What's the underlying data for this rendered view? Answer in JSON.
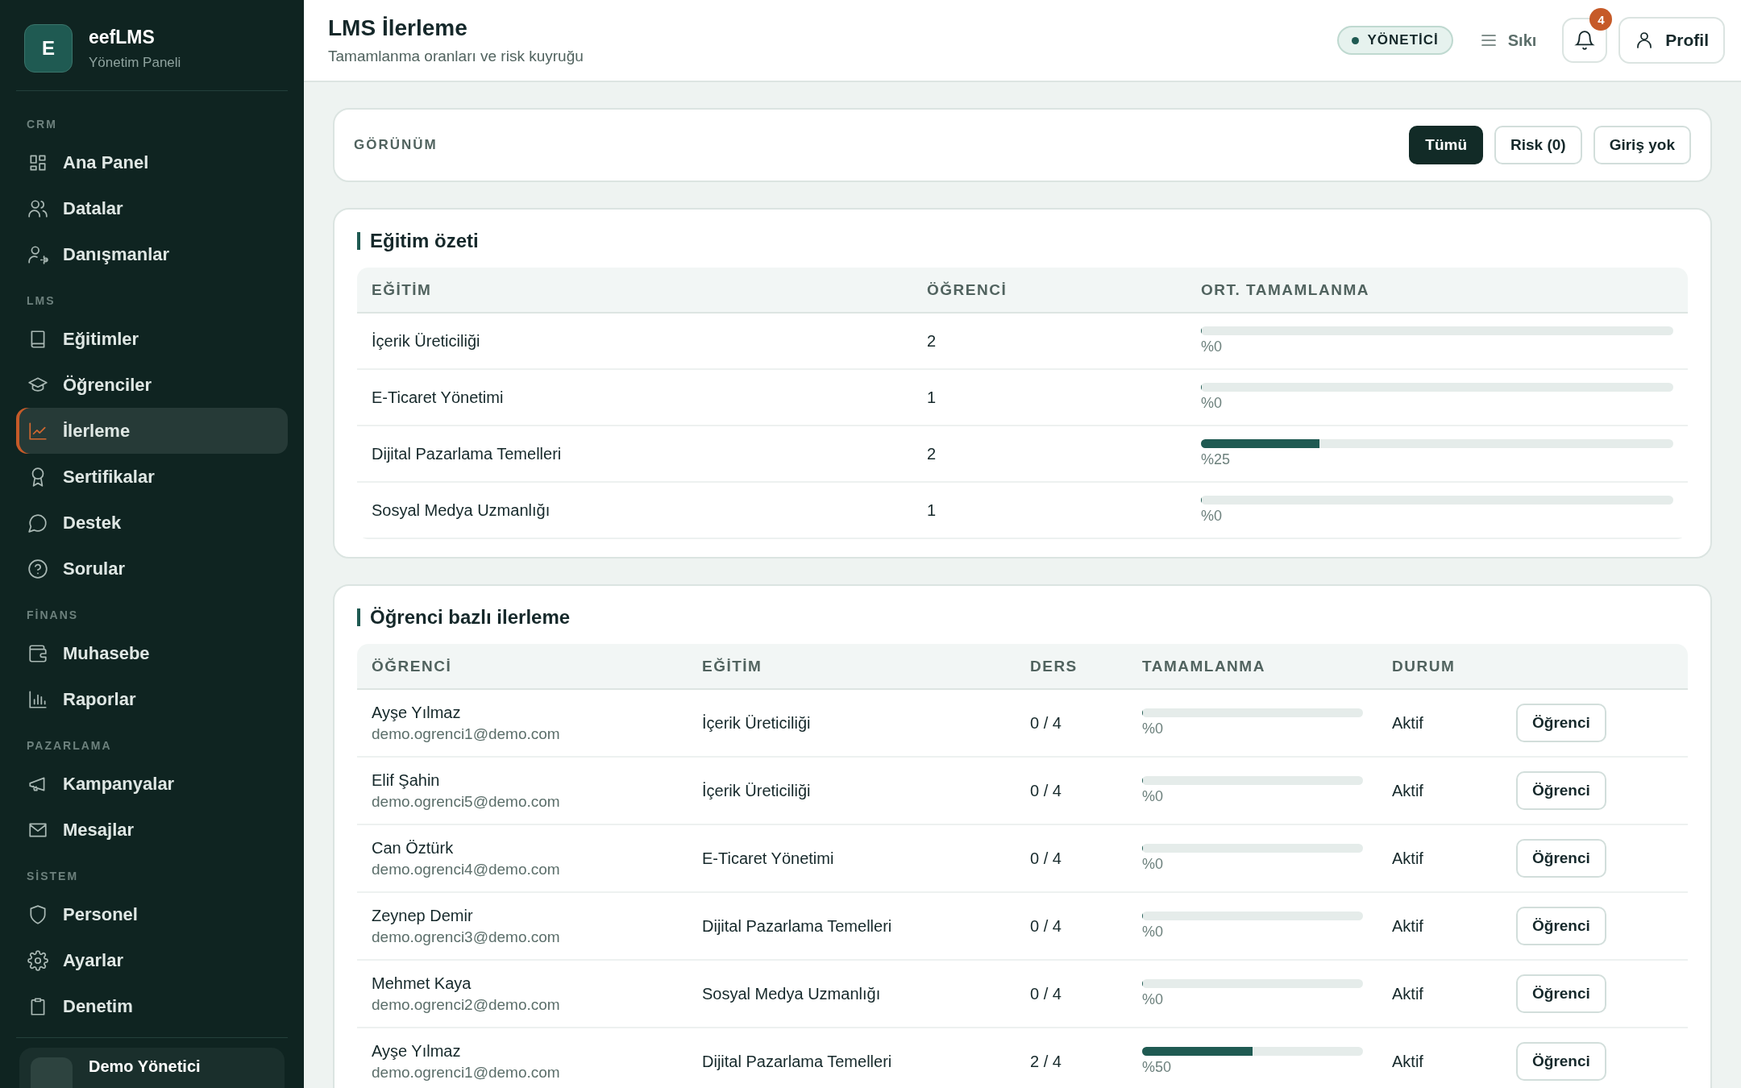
{
  "brand": {
    "initial": "E",
    "name": "eefLMS",
    "subtitle": "Yönetim Paneli"
  },
  "sidebar": {
    "groups": [
      {
        "label": "CRM",
        "items": [
          {
            "label": "Ana Panel",
            "selected": false
          },
          {
            "label": "Datalar",
            "selected": false
          },
          {
            "label": "Danışmanlar",
            "selected": false
          }
        ]
      },
      {
        "label": "LMS",
        "items": [
          {
            "label": "Eğitimler",
            "selected": false
          },
          {
            "label": "Öğrenciler",
            "selected": false
          },
          {
            "label": "İlerleme",
            "selected": true
          },
          {
            "label": "Sertifikalar",
            "selected": false
          },
          {
            "label": "Destek",
            "selected": false
          },
          {
            "label": "Sorular",
            "selected": false
          }
        ]
      },
      {
        "label": "FİNANS",
        "items": [
          {
            "label": "Muhasebe",
            "selected": false
          },
          {
            "label": "Raporlar",
            "selected": false
          }
        ]
      },
      {
        "label": "PAZARLAMA",
        "items": [
          {
            "label": "Kampanyalar",
            "selected": false
          },
          {
            "label": "Mesajlar",
            "selected": false
          }
        ]
      },
      {
        "label": "SİSTEM",
        "items": [
          {
            "label": "Personel",
            "selected": false
          },
          {
            "label": "Ayarlar",
            "selected": false
          },
          {
            "label": "Denetim",
            "selected": false
          }
        ]
      }
    ],
    "user": {
      "name": "Demo Yönetici"
    }
  },
  "header": {
    "title": "LMS İlerleme",
    "subtitle": "Tamamlanma oranları ve risk kuyruğu",
    "role": "YÖNETİCİ",
    "density": "Sıkı",
    "notifications": "4",
    "profile": "Profil"
  },
  "view": {
    "label": "GÖRÜNÜM",
    "filters": [
      {
        "label": "Tümü",
        "selected": true
      },
      {
        "label": "Risk (0)",
        "selected": false
      },
      {
        "label": "Giriş yok",
        "selected": false
      }
    ]
  },
  "summary": {
    "title": "Eğitim özeti",
    "columns": [
      "EĞİTİM",
      "ÖĞRENCİ",
      "ORT. TAMAMLANMA"
    ],
    "rows": [
      {
        "course": "İçerik Üreticiliği",
        "students": "2",
        "level": 0,
        "percent": "%0"
      },
      {
        "course": "E-Ticaret Yönetimi",
        "students": "1",
        "level": 0,
        "percent": "%0"
      },
      {
        "course": "Dijital Pazarlama Temelleri",
        "students": "2",
        "level": 0.25,
        "percent": "%25"
      },
      {
        "course": "Sosyal Medya Uzmanlığı",
        "students": "1",
        "level": 0,
        "percent": "%0"
      }
    ]
  },
  "students": {
    "title": "Öğrenci bazlı ilerleme",
    "columns": [
      "ÖĞRENCİ",
      "EĞİTİM",
      "DERS",
      "TAMAMLANMA",
      "DURUM"
    ],
    "rows": [
      {
        "name": "Ayşe Yılmaz",
        "email": "demo.ogrenci1@demo.com",
        "course": "İçerik Üreticiliği",
        "lessons": "0 / 4",
        "level": 0,
        "percent": "%0",
        "status": "Aktif",
        "action": "Öğrenci"
      },
      {
        "name": "Elif Şahin",
        "email": "demo.ogrenci5@demo.com",
        "course": "İçerik Üreticiliği",
        "lessons": "0 / 4",
        "level": 0,
        "percent": "%0",
        "status": "Aktif",
        "action": "Öğrenci"
      },
      {
        "name": "Can Öztürk",
        "email": "demo.ogrenci4@demo.com",
        "course": "E-Ticaret Yönetimi",
        "lessons": "0 / 4",
        "level": 0,
        "percent": "%0",
        "status": "Aktif",
        "action": "Öğrenci"
      },
      {
        "name": "Zeynep Demir",
        "email": "demo.ogrenci3@demo.com",
        "course": "Dijital Pazarlama Temelleri",
        "lessons": "0 / 4",
        "level": 0,
        "percent": "%0",
        "status": "Aktif",
        "action": "Öğrenci"
      },
      {
        "name": "Mehmet Kaya",
        "email": "demo.ogrenci2@demo.com",
        "course": "Sosyal Medya Uzmanlığı",
        "lessons": "0 / 4",
        "level": 0,
        "percent": "%0",
        "status": "Aktif",
        "action": "Öğrenci"
      },
      {
        "name": "Ayşe Yılmaz",
        "email": "demo.ogrenci1@demo.com",
        "course": "Dijital Pazarlama Temelleri",
        "lessons": "2 / 4",
        "level": 0.5,
        "percent": "%50",
        "status": "Aktif",
        "action": "Öğrenci"
      }
    ]
  }
}
